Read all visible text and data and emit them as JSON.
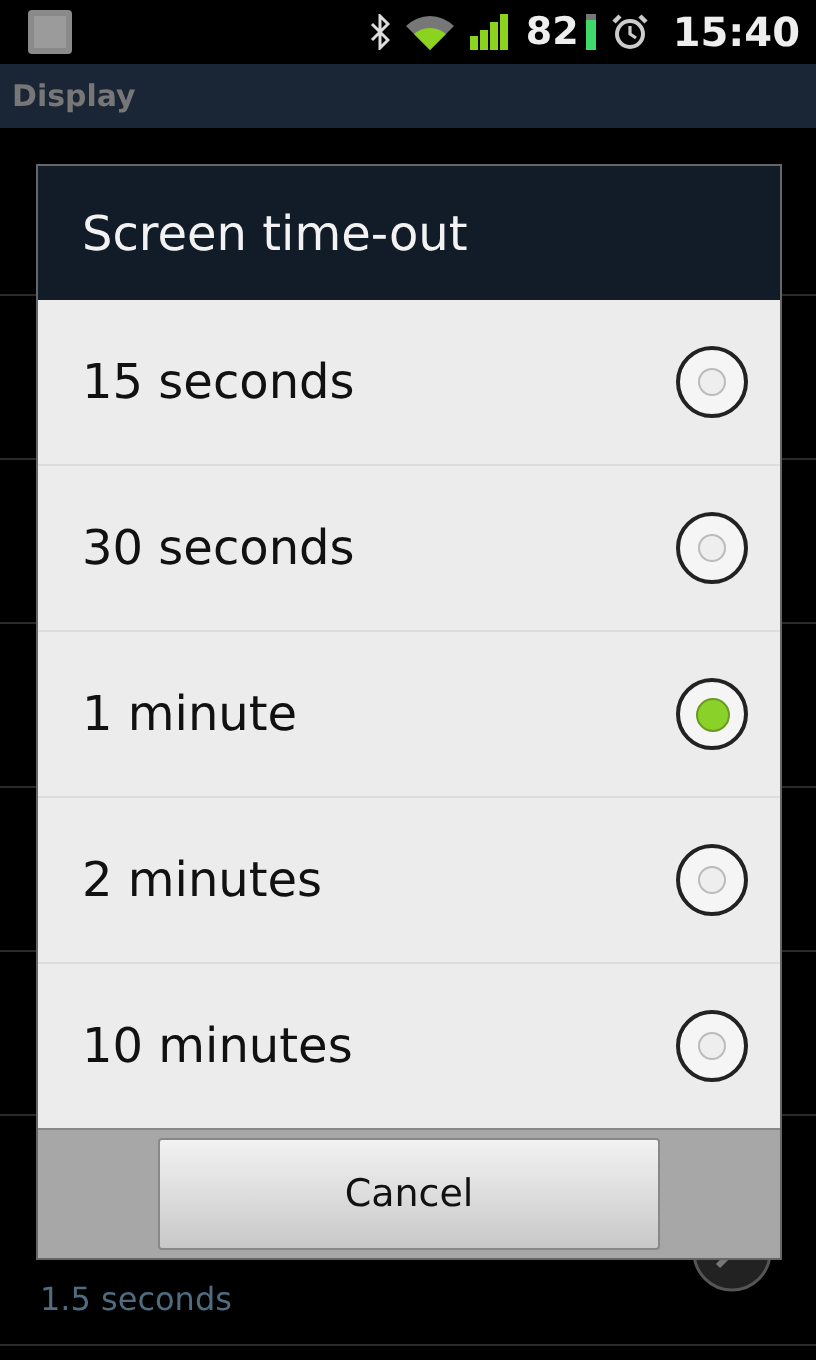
{
  "status_bar": {
    "battery": "82",
    "time": "15:40"
  },
  "title_bar": {
    "title": "Display"
  },
  "background_item": {
    "subtitle": "1.5 seconds"
  },
  "dialog": {
    "title": "Screen time-out",
    "options": [
      {
        "label": "15 seconds",
        "selected": false
      },
      {
        "label": "30 seconds",
        "selected": false
      },
      {
        "label": "1 minute",
        "selected": true
      },
      {
        "label": "2 minutes",
        "selected": false
      },
      {
        "label": "10 minutes",
        "selected": false
      }
    ],
    "buttons": [
      "Cancel"
    ]
  }
}
